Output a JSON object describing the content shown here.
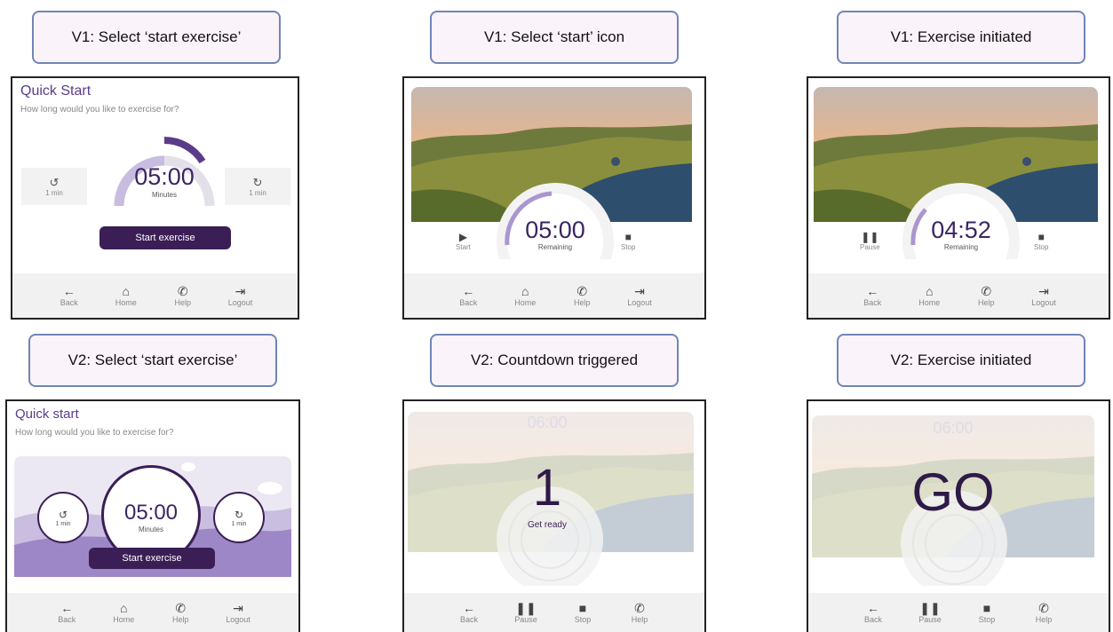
{
  "captions": [
    "V1: Select ‘start exercise’",
    "V1: Select ‘start’ icon",
    "V1: Exercise initiated",
    "V2: Select ‘start exercise’",
    "V2: Countdown triggered",
    "V2: Exercise initiated"
  ],
  "nav4": [
    {
      "icon": "←",
      "label": "Back"
    },
    {
      "icon": "⌂",
      "label": "Home"
    },
    {
      "icon": "✆",
      "label": "Help"
    },
    {
      "icon": "⇥",
      "label": "Logout"
    }
  ],
  "nav_play": [
    {
      "icon": "←",
      "label": "Back"
    },
    {
      "icon": "❚❚",
      "label": "Pause"
    },
    {
      "icon": "■",
      "label": "Stop"
    },
    {
      "icon": "✆",
      "label": "Help"
    }
  ],
  "p1": {
    "title": "Quick Start",
    "subtitle": "How long would you like to exercise for?",
    "time": "05:00",
    "unit": "Minutes",
    "minus_label": "1 min",
    "plus_label": "1 min",
    "button": "Start exercise"
  },
  "p2": {
    "time": "05:00",
    "unit": "Remaining",
    "start": "Start",
    "stop": "Stop"
  },
  "p3": {
    "time": "04:52",
    "unit": "Remaining",
    "pause": "Pause",
    "stop": "Stop"
  },
  "p4": {
    "title": "Quick start",
    "subtitle": "How long would you like to exercise for?",
    "time": "05:00",
    "unit": "Minutes",
    "minus_label": "1 min",
    "plus_label": "1 min",
    "button": "Start exercise"
  },
  "p5": {
    "faded_time": "06:00",
    "count": "1",
    "message": "Get ready"
  },
  "p6": {
    "faded_time": "06:00",
    "word": "GO"
  },
  "colors": {
    "accent": "#3a1e55",
    "ring": "#a996cf"
  }
}
